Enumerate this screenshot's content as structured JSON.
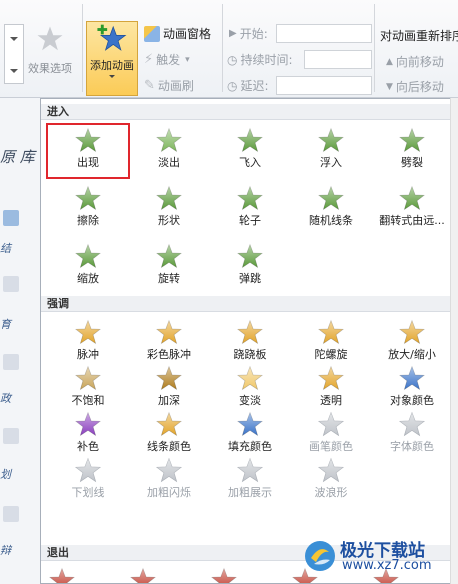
{
  "ribbon": {
    "effect_options": "效果选项",
    "add_animation": "添加动画",
    "animation_pane": "动画窗格",
    "trigger": "触发",
    "animation_painter": "动画刷",
    "start_label": "开始:",
    "duration_label": "持续时间:",
    "delay_label": "延迟:",
    "reorder_title": "对动画重新排序",
    "move_earlier": "向前移动",
    "move_later": "向后移动"
  },
  "background": {
    "library_title": "原 库",
    "side_labels": [
      "结",
      "育",
      "政",
      "划",
      "辩"
    ]
  },
  "gallery": {
    "entrance": {
      "title": "进入",
      "items": [
        {
          "label": "出现",
          "icon": "appear-star-icon",
          "color": "#5a9a3a",
          "selected": true
        },
        {
          "label": "淡出",
          "icon": "fade-star-icon",
          "color": "#7cb55a"
        },
        {
          "label": "飞入",
          "icon": "fly-in-star-icon",
          "color": "#5a9a3a"
        },
        {
          "label": "浮入",
          "icon": "float-in-star-icon",
          "color": "#5a9a3a"
        },
        {
          "label": "劈裂",
          "icon": "split-star-icon",
          "color": "#5a9a3a"
        },
        {
          "label": "擦除",
          "icon": "wipe-star-icon",
          "color": "#5a9a3a"
        },
        {
          "label": "形状",
          "icon": "shape-star-icon",
          "color": "#5a9a3a"
        },
        {
          "label": "轮子",
          "icon": "wheel-star-icon",
          "color": "#5a9a3a"
        },
        {
          "label": "随机线条",
          "icon": "random-bars-star-icon",
          "color": "#5a9a3a"
        },
        {
          "label": "翻转式由远...",
          "icon": "flip-star-icon",
          "color": "#5a9a3a"
        },
        {
          "label": "缩放",
          "icon": "zoom-star-icon",
          "color": "#5a9a3a"
        },
        {
          "label": "旋转",
          "icon": "swivel-star-icon",
          "color": "#5a9a3a"
        },
        {
          "label": "弹跳",
          "icon": "bounce-star-icon",
          "color": "#5a9a3a"
        }
      ]
    },
    "emphasis": {
      "title": "强调",
      "items": [
        {
          "label": "脉冲",
          "icon": "pulse-star-icon",
          "color": "#e3a52b"
        },
        {
          "label": "彩色脉冲",
          "icon": "color-pulse-star-icon",
          "color": "#e3a52b"
        },
        {
          "label": "跷跷板",
          "icon": "teeter-star-icon",
          "color": "#e3a52b"
        },
        {
          "label": "陀螺旋",
          "icon": "spin-star-icon",
          "color": "#e3a52b"
        },
        {
          "label": "放大/缩小",
          "icon": "grow-shrink-star-icon",
          "color": "#e3a52b"
        },
        {
          "label": "不饱和",
          "icon": "desaturate-star-icon",
          "color": "#c9a55a"
        },
        {
          "label": "加深",
          "icon": "darken-star-icon",
          "color": "#b07d1e"
        },
        {
          "label": "变淡",
          "icon": "lighten-star-icon",
          "color": "#f0c86a"
        },
        {
          "label": "透明",
          "icon": "transparency-star-icon",
          "color": "#e3a52b"
        },
        {
          "label": "对象颜色",
          "icon": "object-color-star-icon",
          "color": "#3b74c9"
        },
        {
          "label": "补色",
          "icon": "complementary-color-star-icon",
          "color": "#8b3fbf"
        },
        {
          "label": "线条颜色",
          "icon": "line-color-star-icon",
          "color": "#e3a52b"
        },
        {
          "label": "填充颜色",
          "icon": "fill-color-star-icon",
          "color": "#3b74c9"
        },
        {
          "label": "画笔颜色",
          "icon": "brush-color-star-icon",
          "color": "#c0c4ca",
          "disabled": true
        },
        {
          "label": "字体颜色",
          "icon": "font-color-star-icon",
          "color": "#c0c4ca",
          "disabled": true
        },
        {
          "label": "下划线",
          "icon": "underline-star-icon",
          "color": "#c0c4ca",
          "disabled": true
        },
        {
          "label": "加粗闪烁",
          "icon": "bold-flash-star-icon",
          "color": "#c0c4ca",
          "disabled": true
        },
        {
          "label": "加粗展示",
          "icon": "bold-reveal-star-icon",
          "color": "#c0c4ca",
          "disabled": true
        },
        {
          "label": "波浪形",
          "icon": "wave-star-icon",
          "color": "#c0c4ca",
          "disabled": true
        }
      ]
    },
    "exit": {
      "title": "退出"
    }
  },
  "watermark": {
    "title": "极光下载站",
    "url": "www.xz7.com"
  }
}
